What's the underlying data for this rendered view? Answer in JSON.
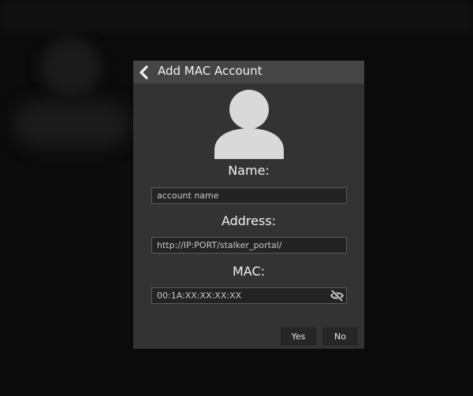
{
  "dialog": {
    "title": "Add MAC Account",
    "icons": {
      "back": "chevron-left-icon",
      "avatar": "user-silhouette-icon",
      "mac_visibility": "eye-slash-icon"
    },
    "fields": {
      "name": {
        "label": "Name:",
        "placeholder": "account name"
      },
      "address": {
        "label": "Address:",
        "placeholder": "http://IP:PORT/stalker_portal/"
      },
      "mac": {
        "label": "MAC:",
        "placeholder": "00:1A:XX:XX:XX:XX"
      }
    },
    "buttons": {
      "yes": "Yes",
      "no": "No"
    }
  },
  "colors": {
    "backdrop": "#0b0b0b",
    "dialog_bg": "#333333",
    "header_bg": "#454545",
    "input_bg": "#232323",
    "button_bg": "#262626",
    "text": "#f2f2f2",
    "avatar": "#d9d9d9"
  }
}
